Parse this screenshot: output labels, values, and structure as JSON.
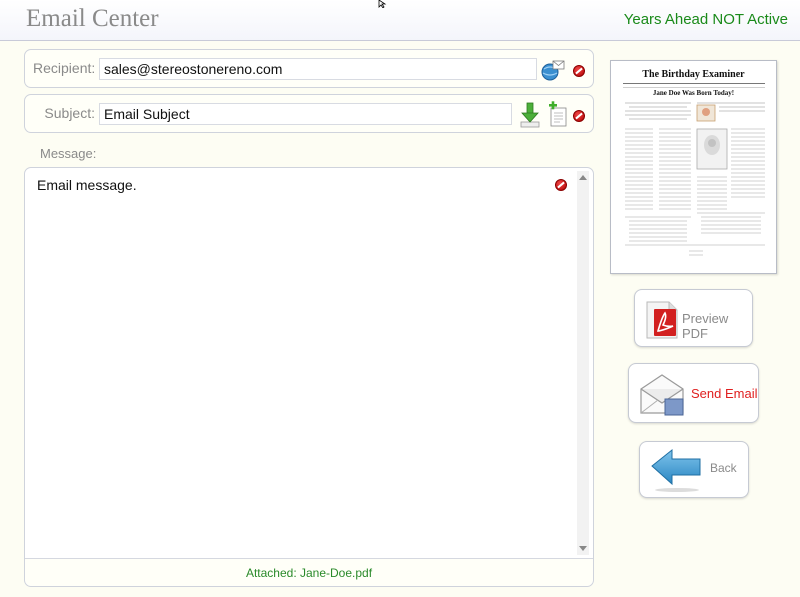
{
  "header": {
    "title": "Email Center",
    "status": "Years Ahead NOT Active"
  },
  "recipient": {
    "label": "Recipient:",
    "value": "sales@stereostonereno.com"
  },
  "subject": {
    "label": "Subject:",
    "value": "Email Subject"
  },
  "message": {
    "label": "Message:",
    "text": "Email message."
  },
  "attachment": {
    "text": "Attached: Jane-Doe.pdf"
  },
  "preview": {
    "newspaper_title": "The Birthday Examiner",
    "headline": "Jane Doe Was Born Today!"
  },
  "buttons": {
    "preview_pdf": "Preview PDF",
    "send_email": "Send Email",
    "back": "Back"
  },
  "colors": {
    "status": "#1a8a1a",
    "send_label": "#e02020",
    "attachment": "#2a8a2a",
    "accent_blue": "#3a8fd0"
  }
}
